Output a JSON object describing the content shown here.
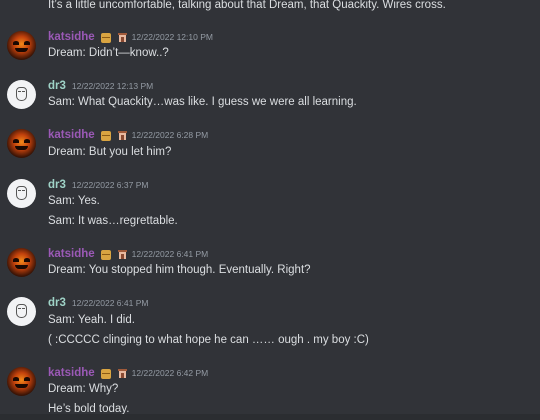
{
  "messages": {
    "top_line": "It’s a little uncomfortable, talking about that Dream, that Quackity. Wires cross.",
    "m1": {
      "author": "katsidhe",
      "time": "12/22/2022 12:10 PM",
      "lines": [
        "Dream: Didn’t—know..?"
      ]
    },
    "m2": {
      "author": "dr3",
      "time": "12/22/2022 12:13 PM",
      "lines": [
        "Sam: What Quackity…was like. I guess we were all learning."
      ]
    },
    "m3": {
      "author": "katsidhe",
      "time": "12/22/2022 6:28 PM",
      "lines": [
        "Dream: But you let him?"
      ]
    },
    "m4": {
      "author": "dr3",
      "time": "12/22/2022 6:37 PM",
      "lines": [
        "Sam: Yes.",
        "Sam: It was…regrettable."
      ]
    },
    "m5": {
      "author": "katsidhe",
      "time": "12/22/2022 6:41 PM",
      "lines": [
        "Dream: You stopped him though. Eventually. Right?"
      ]
    },
    "m6": {
      "author": "dr3",
      "time": "12/22/2022 6:41 PM",
      "lines": [
        "Sam: Yeah. I did.",
        "( :CCCCC clinging to what hope he can …… ough . my boy :C)"
      ]
    },
    "m7": {
      "author": "katsidhe",
      "time": "12/22/2022 6:42 PM",
      "lines": [
        "Dream: Why?",
        "He’s bold today."
      ]
    }
  },
  "icons": {
    "katsidhe_badges": [
      "package-icon",
      "tower-icon"
    ],
    "katsidhe_avatar": "jack-o-lantern-avatar",
    "dr3_avatar": "sketch-face-avatar"
  },
  "colors": {
    "background": "#313338",
    "katsidhe_name": "#9b59b6",
    "dr3_name": "#9fd3c7",
    "timestamp": "#949ba4",
    "text": "#dbdee1"
  }
}
